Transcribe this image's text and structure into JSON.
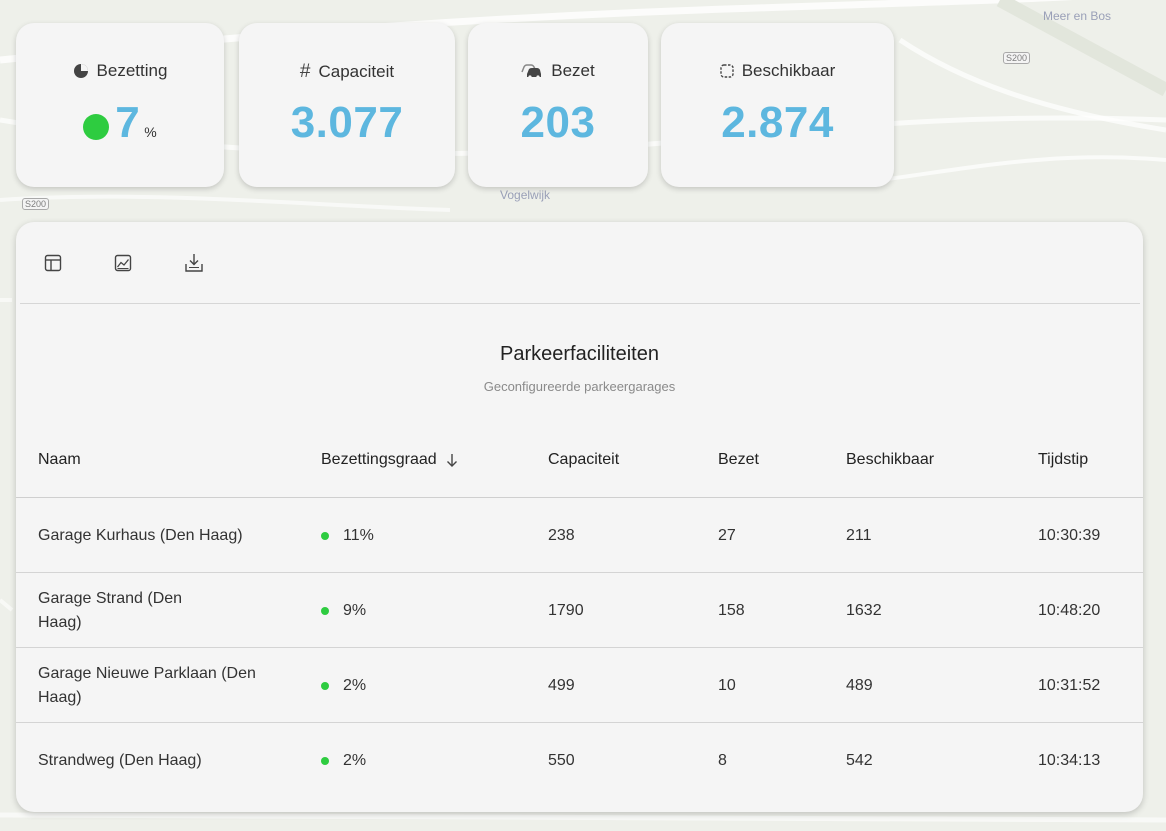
{
  "map": {
    "labels": [
      "Meer en Bos",
      "Vogelwijk"
    ],
    "shields": [
      "S200",
      "S200"
    ]
  },
  "kpis": [
    {
      "label": "Bezetting",
      "value": "7",
      "unit": "%",
      "icon": "pie-chart-icon",
      "status_color": "#2ecc40"
    },
    {
      "label": "Capaciteit",
      "value": "3.077",
      "icon": "hash-icon"
    },
    {
      "label": "Bezet",
      "value": "203",
      "icon": "car-icon"
    },
    {
      "label": "Beschikbaar",
      "value": "2.874",
      "icon": "empty-square-icon"
    }
  ],
  "toolbar": {
    "icons": [
      "table-view-icon",
      "chart-view-icon",
      "download-icon"
    ]
  },
  "table": {
    "title": "Parkeerfaciliteiten",
    "subtitle": "Geconfigureerde parkeergarages",
    "columns": [
      "Naam",
      "Bezettingsgraad",
      "Capaciteit",
      "Bezet",
      "Beschikbaar",
      "Tijdstip"
    ],
    "sort_column": "Bezettingsgraad",
    "sort_direction": "descending",
    "rows": [
      {
        "name": "Garage Kurhaus (Den Haag)",
        "occupancy": "11%",
        "capacity": "238",
        "occupied": "27",
        "available": "211",
        "time": "10:30:39"
      },
      {
        "name": "Garage Strand (Den Haag)",
        "occupancy": "9%",
        "capacity": "1790",
        "occupied": "158",
        "available": "1632",
        "time": "10:48:20"
      },
      {
        "name": "Garage Nieuwe Parklaan (Den Haag)",
        "occupancy": "2%",
        "capacity": "499",
        "occupied": "10",
        "available": "489",
        "time": "10:31:52"
      },
      {
        "name": "Strandweg (Den Haag)",
        "occupancy": "2%",
        "capacity": "550",
        "occupied": "8",
        "available": "542",
        "time": "10:34:13"
      }
    ]
  },
  "colors": {
    "accent": "#5db7df",
    "status_ok": "#2ecc40",
    "card_bg": "#f5f5f5"
  }
}
